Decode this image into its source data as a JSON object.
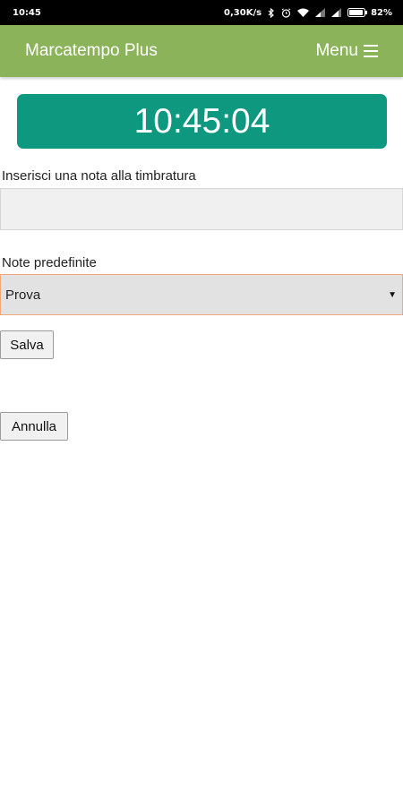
{
  "status_bar": {
    "time": "10:45",
    "network_speed": "0,30K/s",
    "battery_percent": "82%",
    "icons": [
      "bluetooth-icon",
      "alarm-icon",
      "wifi-icon",
      "signal-icon",
      "signal-icon",
      "battery-icon"
    ]
  },
  "app_bar": {
    "title": "Marcatempo Plus",
    "menu_label": "Menu",
    "menu_icon": "hamburger-icon",
    "color": "#8bb35a"
  },
  "clock": {
    "time": "10:45:04",
    "color": "#0f9880"
  },
  "note": {
    "label": "Inserisci una nota alla timbratura",
    "value": "",
    "placeholder": ""
  },
  "preset_notes": {
    "label": "Note predefinite",
    "selected": "Prova"
  },
  "buttons": {
    "save_label": "Salva",
    "cancel_label": "Annulla"
  }
}
